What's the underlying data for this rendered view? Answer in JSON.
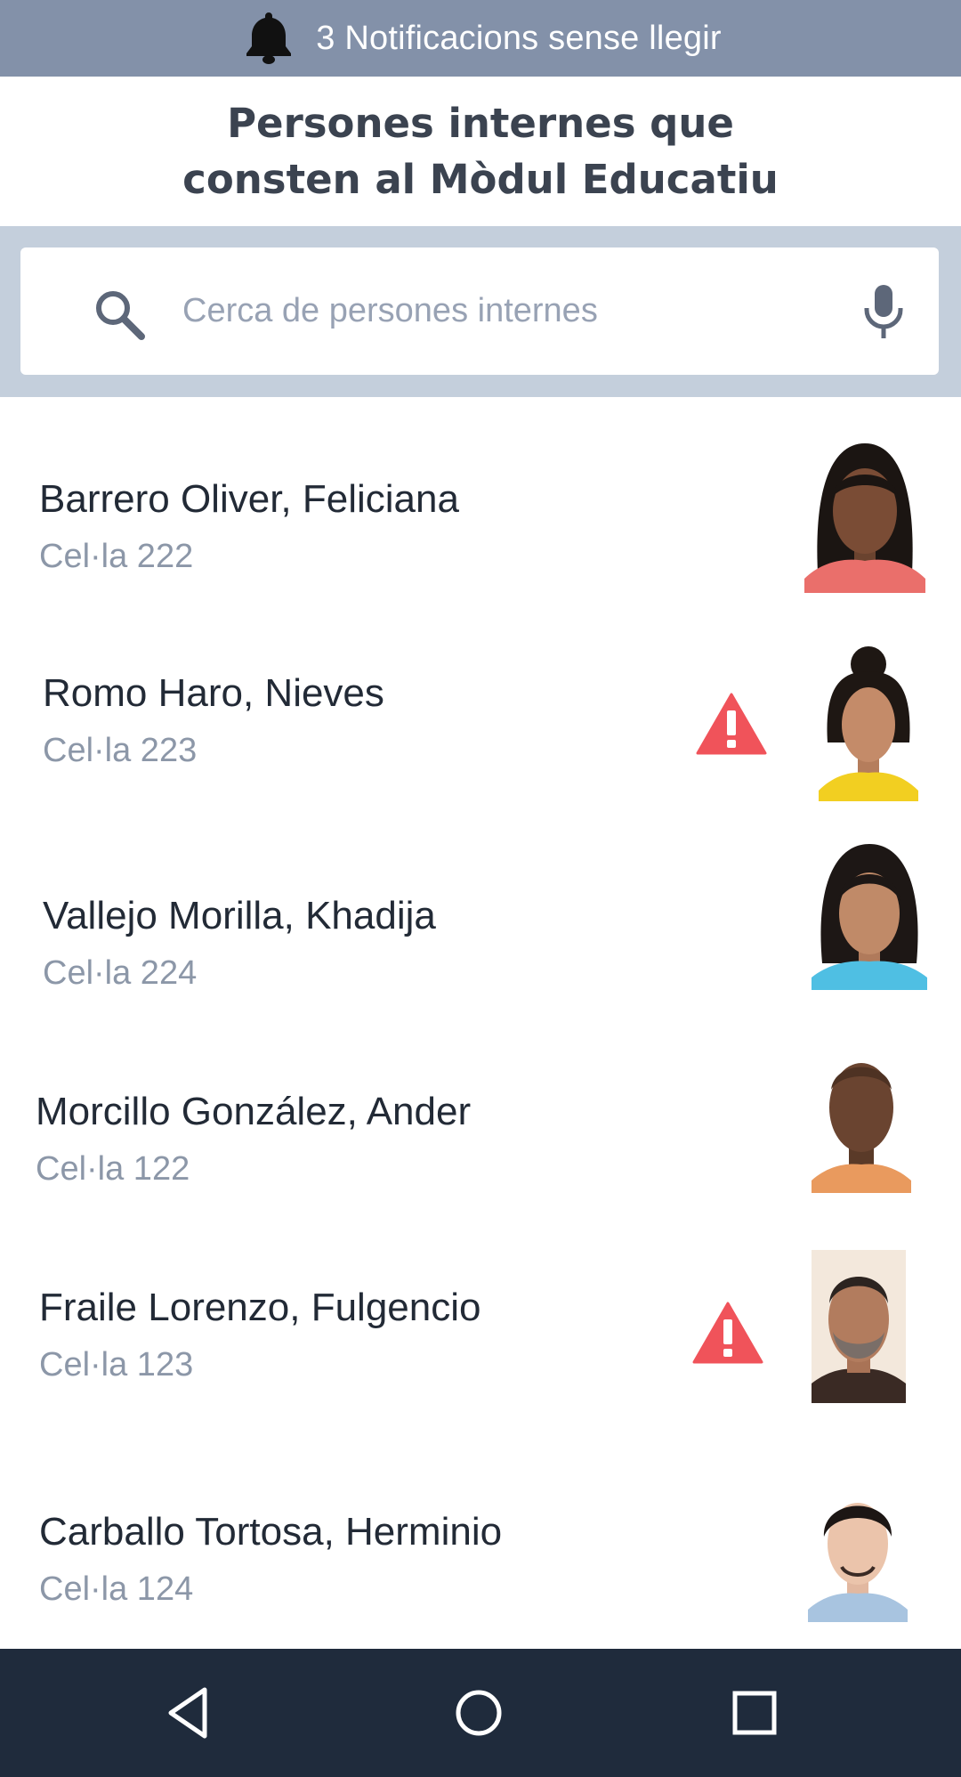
{
  "notifications": {
    "text": "3 Notificacions sense llegir",
    "icon": "bell-icon"
  },
  "page": {
    "title": "Persones internes que consten al Mòdul Educatiu"
  },
  "search": {
    "placeholder": "Cerca de persones internes",
    "value": "",
    "search_icon": "search-icon",
    "mic_icon": "microphone-icon"
  },
  "inmates": [
    {
      "name": "Barrero Oliver, Feliciana",
      "cell": "Cel·la 222",
      "alert": false
    },
    {
      "name": "Romo Haro, Nieves",
      "cell": "Cel·la 223",
      "alert": true
    },
    {
      "name": "Vallejo Morilla, Khadija",
      "cell": "Cel·la 224",
      "alert": false
    },
    {
      "name": "Morcillo González, Ander",
      "cell": "Cel·la 122",
      "alert": false
    },
    {
      "name": "Fraile Lorenzo, Fulgencio",
      "cell": "Cel·la 123",
      "alert": true
    },
    {
      "name": "Carballo Tortosa, Herminio",
      "cell": "Cel·la 124",
      "alert": false
    }
  ],
  "navigation": {
    "back_icon": "back-triangle-icon",
    "home_icon": "home-circle-icon",
    "recents_icon": "recents-square-icon"
  },
  "colors": {
    "notification_bar": "#8391a9",
    "search_band": "#c4cfdc",
    "alert": "#f0535a",
    "navbar": "#1f2b3c",
    "title_text": "#3b4350",
    "secondary_text": "#8c97a8"
  }
}
